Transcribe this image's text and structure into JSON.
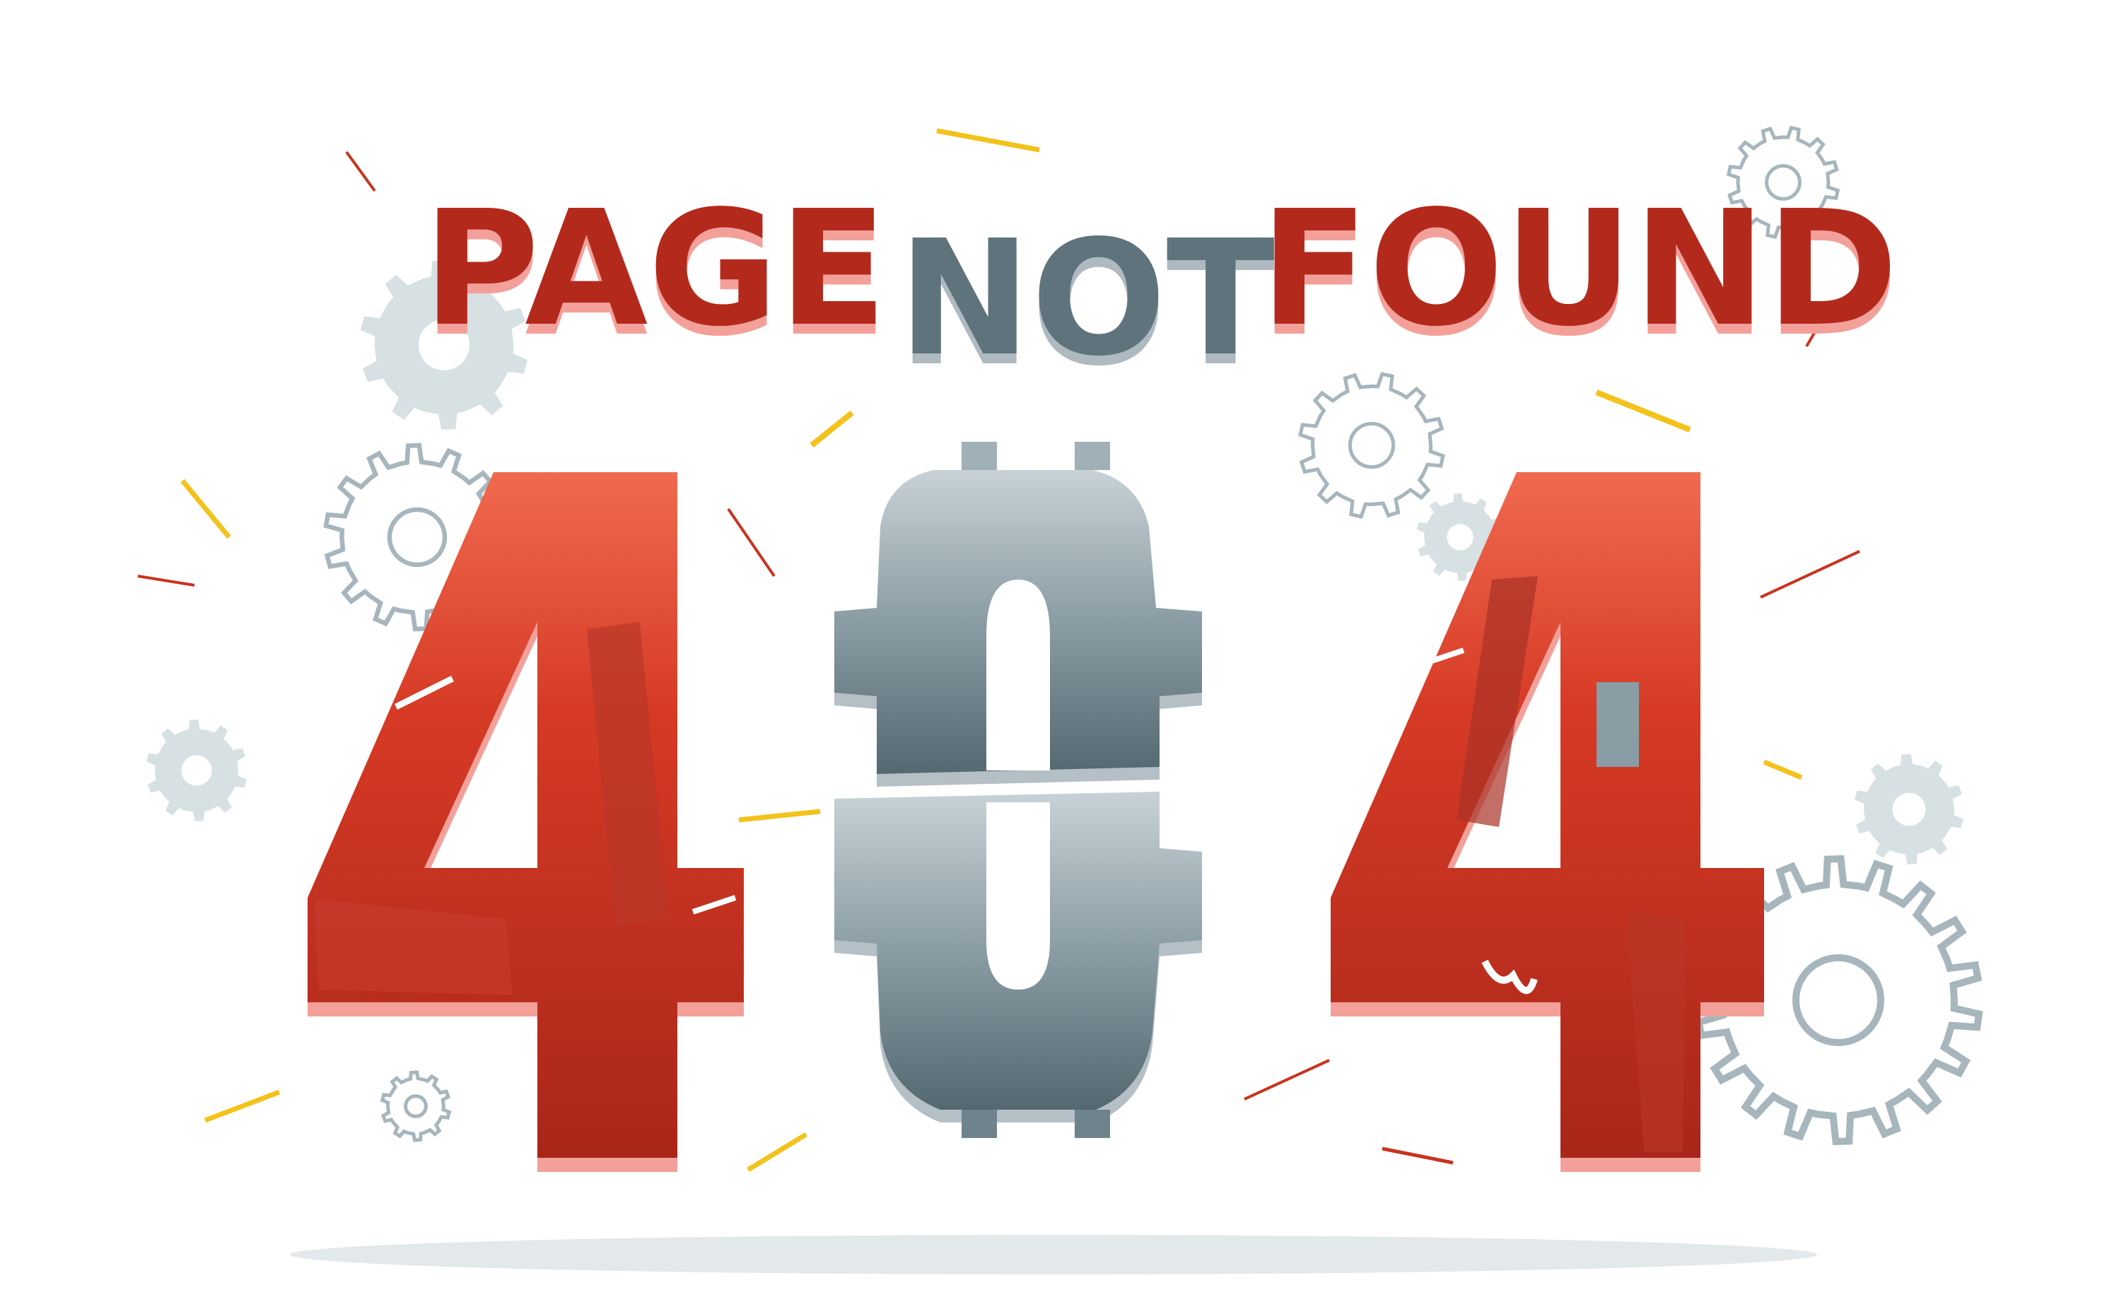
{
  "headline": {
    "word1": "PAGE",
    "word2": "NOT",
    "word3": "FOUND"
  },
  "code": {
    "digit1": "4",
    "digit2": "0",
    "digit3": "4"
  },
  "colors": {
    "red": "#d03a26",
    "dark_red": "#a9261a",
    "grey": "#6f8690",
    "gear_light": "#d7e0e3",
    "gear_outline": "#a7b6bd",
    "yellow": "#f3c21b"
  },
  "icons": [
    "gear-icon",
    "gear-icon",
    "gear-icon",
    "gear-icon",
    "gear-icon",
    "gear-icon",
    "gear-icon",
    "gear-icon",
    "gear-icon"
  ]
}
